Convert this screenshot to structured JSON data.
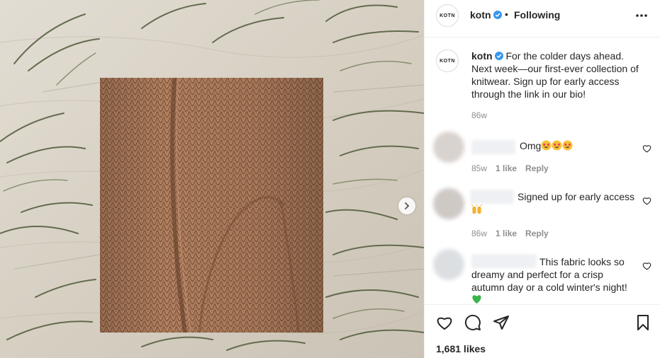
{
  "post": {
    "account": {
      "username": "kotn",
      "avatar_text": "KOTN",
      "verified": true,
      "follow_state": "Following"
    },
    "caption": {
      "text": "For the colder days ahead. Next week—our first-ever collection of knitwear. Sign up for early access through the link in our bio!",
      "time": "86w"
    },
    "comments": [
      {
        "username": "",
        "text": "Omg",
        "emojis": [
          "star-struck",
          "star-struck",
          "star-struck"
        ],
        "time": "85w",
        "likes": "1 like",
        "reply_label": "Reply"
      },
      {
        "username": "",
        "text": "Signed up for early access",
        "emojis": [
          "raising-hands"
        ],
        "time": "86w",
        "likes": "1 like",
        "reply_label": "Reply"
      },
      {
        "username": "",
        "text": "This fabric looks so dreamy and perfect for a crisp autumn day or a cold winter's night!",
        "emojis": [
          "green-heart"
        ]
      }
    ],
    "likes": "1,681 likes",
    "icons": {
      "like": "heart-icon",
      "comment": "comment-icon",
      "share": "paper-plane-icon",
      "save": "bookmark-icon",
      "more": "more-options-icon",
      "carousel": "chevron-right-icon"
    }
  },
  "colors": {
    "text": "#262626",
    "secondary": "#8e8e8e",
    "verified_blue": "#3897f0",
    "divider": "#efefef"
  }
}
